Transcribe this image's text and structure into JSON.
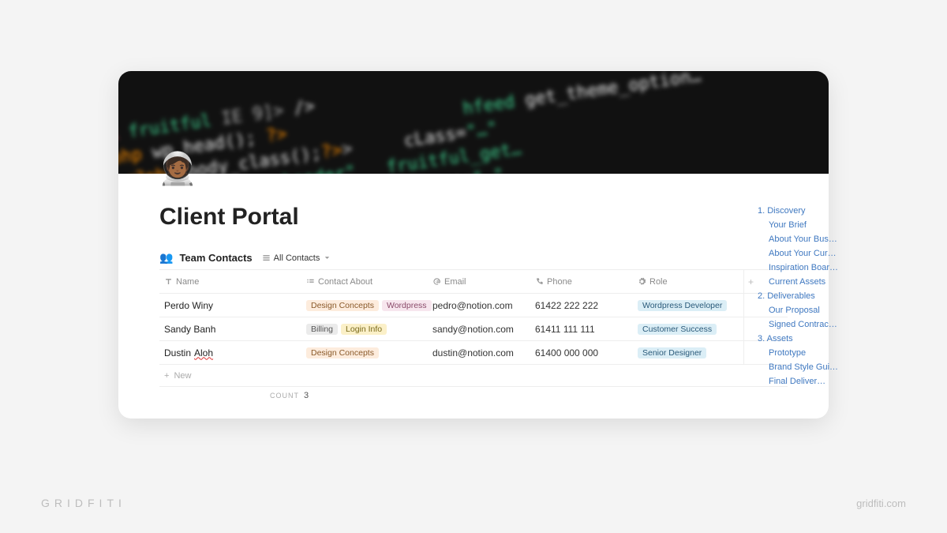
{
  "page": {
    "icon": "🧑🏾‍🚀",
    "title": "Client Portal"
  },
  "database": {
    "icon": "👥",
    "title": "Team Contacts",
    "view_label": "All Contacts",
    "columns": {
      "name": "Name",
      "contact_about": "Contact About",
      "email": "Email",
      "phone": "Phone",
      "role": "Role"
    },
    "rows": [
      {
        "name": "Perdo Winy",
        "tags": [
          {
            "label": "Design Concepts",
            "color": "orange"
          },
          {
            "label": "Wordpress",
            "color": "pink"
          }
        ],
        "email": "pedro@notion.com",
        "phone": "61422 222 222",
        "role": {
          "label": "Wordpress Developer",
          "color": "blue"
        }
      },
      {
        "name": "Sandy Banh",
        "tags": [
          {
            "label": "Billing",
            "color": "grey"
          },
          {
            "label": "Login Info",
            "color": "yellow"
          }
        ],
        "email": "sandy@notion.com",
        "phone": "61411 111 111",
        "role": {
          "label": "Customer Success",
          "color": "blue"
        }
      },
      {
        "name": "Dustin Aloh",
        "name_underlined_part": "Aloh",
        "tags": [
          {
            "label": "Design Concepts",
            "color": "orange"
          }
        ],
        "email": "dustin@notion.com",
        "phone": "61400 000 000",
        "role": {
          "label": "Senior Designer",
          "color": "blue"
        }
      }
    ],
    "new_label": "New",
    "count_label": "COUNT",
    "count_value": "3"
  },
  "toc": [
    {
      "level": 1,
      "label": "1. Discovery"
    },
    {
      "level": 2,
      "label": "Your Brief"
    },
    {
      "level": 2,
      "label": "About Your Bus…"
    },
    {
      "level": 2,
      "label": "About Your Cur…"
    },
    {
      "level": 2,
      "label": "Inspiration Boar…"
    },
    {
      "level": 2,
      "label": "Current Assets"
    },
    {
      "level": 1,
      "label": "2. Deliverables"
    },
    {
      "level": 2,
      "label": "Our Proposal"
    },
    {
      "level": 2,
      "label": "Signed Contrac…"
    },
    {
      "level": 1,
      "label": "3. Assets"
    },
    {
      "level": 2,
      "label": "Prototype"
    },
    {
      "level": 2,
      "label": "Brand Style Gui…"
    },
    {
      "level": 2,
      "label": "Final Deliver…"
    }
  ],
  "branding": {
    "left": "GRIDFITI",
    "right": "gridfiti.com"
  }
}
